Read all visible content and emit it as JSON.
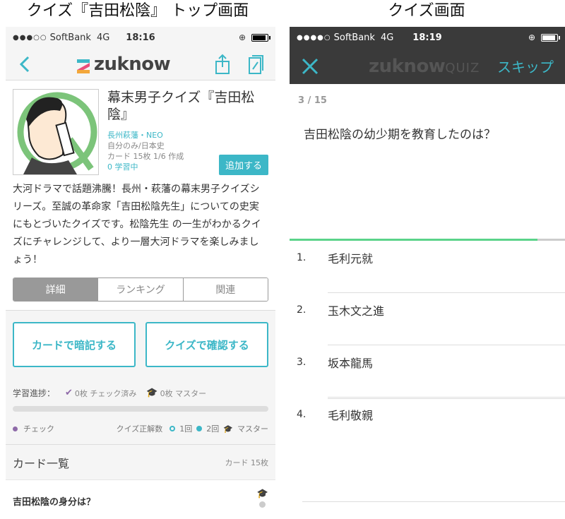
{
  "captions": {
    "left": "クイズ『吉田松陰』 トップ画面",
    "right": "クイズ画面"
  },
  "left_screen": {
    "status": {
      "carrier": "SoftBank",
      "network": "4G",
      "time": "18:16"
    },
    "nav": {
      "logo_text": "zuknow"
    },
    "deck": {
      "title": "幕末男子クイズ『吉田松陰』",
      "author": "長州萩藩・NEO",
      "visibility": "自分のみ/日本史",
      "cards_info": "カード 15枚 1/6 作成",
      "learning": "0 学習中",
      "add_label": "追加する",
      "description": "大河ドラマで話題沸騰！長州・萩藩の幕末男子クイズシリーズ。至誠の革命家「吉田松陰先生」についての史実にもとづいたクイズです。松陰先生 の一生がわかるクイズにチャレンジして、より一層大河ドラマを楽しみましょう！"
    },
    "tabs": [
      {
        "label": "詳細",
        "active": true
      },
      {
        "label": "ランキング",
        "active": false
      },
      {
        "label": "関連",
        "active": false
      }
    ],
    "actions": {
      "memorize": "カードで暗記する",
      "quiz": "クイズで確認する"
    },
    "progress": {
      "label": "学習進捗：",
      "checked": "0枚 チェック済み",
      "mastered": "0枚 マスター",
      "fraction": 0
    },
    "legend": {
      "check": "チェック",
      "quiz_correct": "クイズ正解数",
      "once": "1回",
      "twice": "2回",
      "master": "マスター"
    },
    "card_list": {
      "title": "カード一覧",
      "count": "カード 15枚",
      "items": [
        {
          "question": "吉田松陰の身分は？"
        }
      ]
    },
    "colors": {
      "accent": "#3cb7c7",
      "check": "#8e6aa8"
    }
  },
  "right_screen": {
    "status": {
      "carrier": "SoftBank",
      "network": "4G",
      "time": "18:19"
    },
    "nav": {
      "logo_text": "zuknow",
      "logo_suffix": "QUIZ",
      "skip_label": "スキップ"
    },
    "progress_label": "3 / 15",
    "progress_fraction": 0.9,
    "question": "吉田松陰の幼少期を教育したのは？",
    "choices": [
      {
        "num": "1.",
        "text": "毛利元就"
      },
      {
        "num": "2.",
        "text": "玉木文之進"
      },
      {
        "num": "3.",
        "text": "坂本龍馬"
      },
      {
        "num": "4.",
        "text": "毛利敬親"
      }
    ],
    "colors": {
      "bar": "#5bd38a",
      "skip": "#3cb7c7"
    }
  }
}
